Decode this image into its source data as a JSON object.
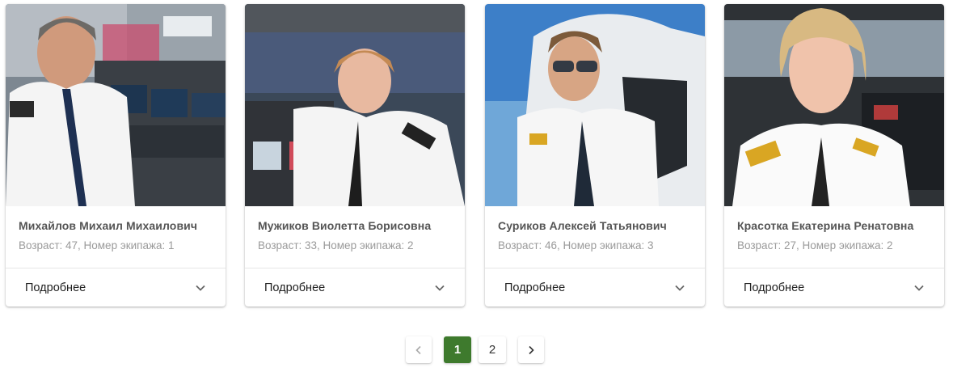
{
  "colors": {
    "accent": "#3e7a2d",
    "name_text": "#555555",
    "meta_text": "#9a9a9a"
  },
  "crew": [
    {
      "name": "Михайлов Михаил Михаилович",
      "meta": "Возраст: 47, Номер экипажа: 1",
      "more_label": "Подробнее",
      "photo": "photo-pilot-male-older-cockpit"
    },
    {
      "name": "Мужиков Виолетта Борисовна",
      "meta": "Возраст: 33, Номер экипажа: 2",
      "more_label": "Подробнее",
      "photo": "photo-pilot-female-cockpit"
    },
    {
      "name": "Суриков Алексей Татьянович",
      "meta": "Возраст: 46, Номер экипажа: 3",
      "more_label": "Подробнее",
      "photo": "photo-pilot-male-sunglasses"
    },
    {
      "name": "Красотка Екатерина Ренатовна",
      "meta": "Возраст: 27, Номер экипажа: 2",
      "more_label": "Подробнее",
      "photo": "photo-pilot-female-blonde-cockpit"
    }
  ],
  "pagination": {
    "prev_icon": "chevron-left-icon",
    "pages": [
      "1",
      "2"
    ],
    "current": "1",
    "next_icon": "chevron-right-icon"
  }
}
